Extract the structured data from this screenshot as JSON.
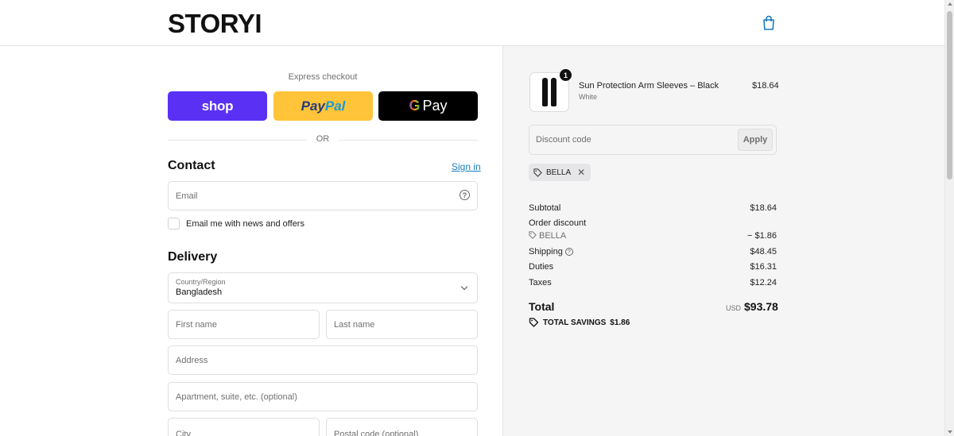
{
  "header": {
    "logo": "STORYI",
    "cart_icon": "shopping-bag-icon"
  },
  "express": {
    "label": "Express checkout",
    "shop_label": "shop",
    "paypal_part1": "Pay",
    "paypal_part2": "Pal",
    "gpay_g": "G",
    "gpay_label": "Pay"
  },
  "divider": {
    "or_label": "OR"
  },
  "contact": {
    "title": "Contact",
    "sign_in": "Sign in",
    "email_placeholder": "Email",
    "newsletter_label": "Email me with news and offers"
  },
  "delivery": {
    "title": "Delivery",
    "country_label": "Country/Region",
    "country_value": "Bangladesh",
    "first_name": "First name",
    "last_name": "Last name",
    "address": "Address",
    "apartment": "Apartment, suite, etc. (optional)",
    "city": "City",
    "postal_code": "Postal code (optional)"
  },
  "cart": {
    "item": {
      "name": "Sun Protection Arm Sleeves – Black",
      "variant": "White",
      "price": "$18.64",
      "quantity": "1"
    },
    "discount_placeholder": "Discount code",
    "apply_label": "Apply",
    "applied_code": "BELLA"
  },
  "summary": {
    "subtotal_label": "Subtotal",
    "subtotal_value": "$18.64",
    "order_discount_label": "Order discount",
    "discount_code": "BELLA",
    "discount_value": "− $1.86",
    "shipping_label": "Shipping",
    "shipping_value": "$48.45",
    "duties_label": "Duties",
    "duties_value": "$16.31",
    "taxes_label": "Taxes",
    "taxes_value": "$12.24",
    "total_label": "Total",
    "currency": "USD",
    "total_value": "$93.78",
    "savings_label": "TOTAL SAVINGS",
    "savings_value": "$1.86"
  },
  "colors": {
    "shop_purple": "#5a31f4",
    "paypal_yellow": "#ffc439",
    "link_blue": "#197bbd",
    "summary_bg": "#f5f5f6"
  }
}
